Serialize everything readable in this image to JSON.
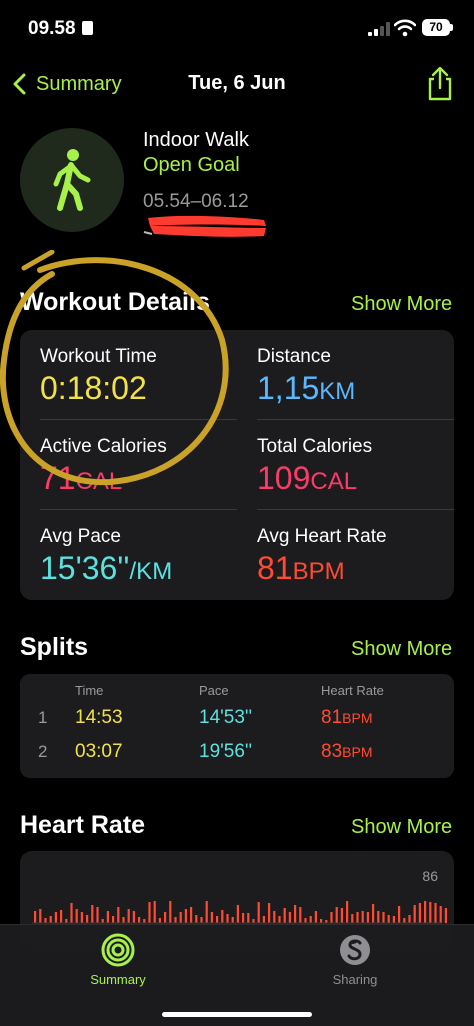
{
  "status": {
    "time": "09.58",
    "battery": "70"
  },
  "nav": {
    "back_label": "Summary",
    "title": "Tue, 6 Jun"
  },
  "workout": {
    "type": "Indoor Walk",
    "goal": "Open Goal",
    "time_range": "05.54–06.12"
  },
  "details": {
    "title": "Workout Details",
    "show_more": "Show More",
    "metrics": [
      {
        "label": "Workout Time",
        "value": "0:18:02",
        "unit": "",
        "color": "#f2e24a"
      },
      {
        "label": "Distance",
        "value": "1,15",
        "unit": "KM",
        "color": "#5ab8ff"
      },
      {
        "label": "Active Calories",
        "value": "71",
        "unit": "CAL",
        "color": "#fa3c68"
      },
      {
        "label": "Total Calories",
        "value": "109",
        "unit": "CAL",
        "color": "#fa3c68"
      },
      {
        "label": "Avg Pace",
        "value": "15'36''",
        "unit": "/KM",
        "color": "#5ce0e0"
      },
      {
        "label": "Avg Heart Rate",
        "value": "81",
        "unit": "BPM",
        "color": "#ff4b33"
      }
    ]
  },
  "splits": {
    "title": "Splits",
    "show_more": "Show More",
    "headers": {
      "time": "Time",
      "pace": "Pace",
      "heart_rate": "Heart Rate"
    },
    "rows": [
      {
        "num": "1",
        "time": "14:53",
        "pace": "14'53''",
        "hr": "81",
        "hr_unit": "BPM"
      },
      {
        "num": "2",
        "time": "03:07",
        "pace": "19'56''",
        "hr": "83",
        "hr_unit": "BPM"
      }
    ],
    "colors": {
      "time": "#f2e24a",
      "pace": "#5ce0e0",
      "hr": "#ff4b33"
    }
  },
  "heart_rate": {
    "title": "Heart Rate",
    "show_more": "Show More",
    "max_label": "86",
    "bar_color": "#ff4b33"
  },
  "tabs": [
    {
      "label": "Summary",
      "icon": "activity-rings-icon",
      "active": true
    },
    {
      "label": "Sharing",
      "icon": "sharing-icon",
      "active": false
    }
  ],
  "colors": {
    "accent": "#a8f04a",
    "card": "#1c1c1e",
    "highlight_circle": "#c9a227"
  }
}
